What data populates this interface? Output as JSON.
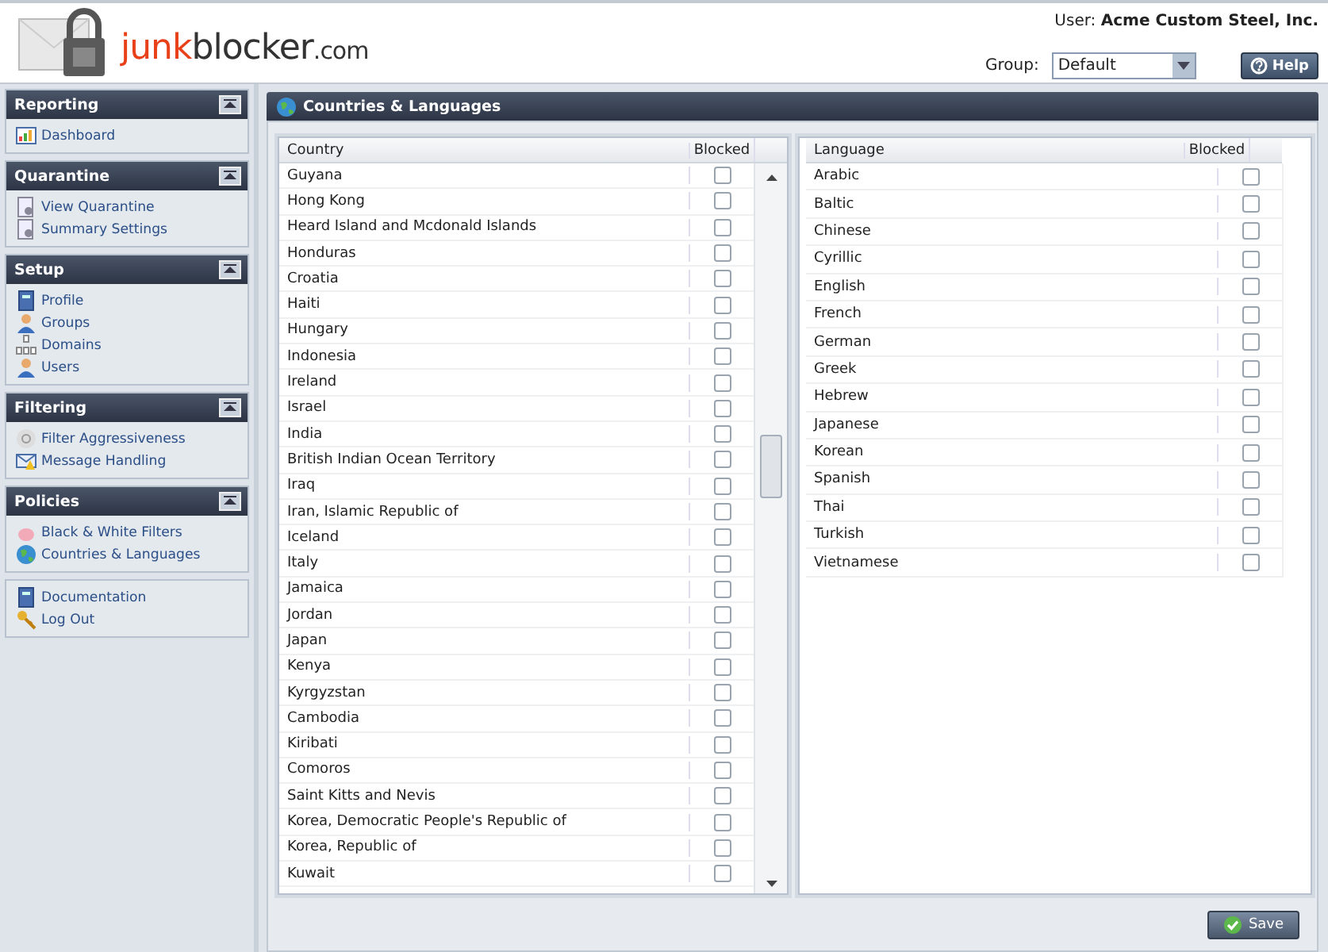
{
  "header": {
    "logo": {
      "accent": "junk",
      "name": "blocker",
      "suffix": ".com"
    },
    "user_label": "User:",
    "user_name": "Acme Custom Steel, Inc.",
    "group_label": "Group:",
    "group_value": "Default",
    "help": "Help"
  },
  "sidebar": [
    {
      "title": "Reporting",
      "items": [
        {
          "label": "Dashboard",
          "selected": false
        }
      ]
    },
    {
      "title": "Quarantine",
      "items": [
        {
          "label": "View Quarantine",
          "selected": false
        },
        {
          "label": "Summary Settings",
          "selected": false
        }
      ]
    },
    {
      "title": "Setup",
      "items": [
        {
          "label": "Profile",
          "selected": false
        },
        {
          "label": "Groups",
          "selected": false
        },
        {
          "label": "Domains",
          "selected": false
        },
        {
          "label": "Users",
          "selected": false
        }
      ]
    },
    {
      "title": "Filtering",
      "items": [
        {
          "label": "Filter Aggressiveness",
          "selected": false
        },
        {
          "label": "Message Handling",
          "selected": false
        }
      ]
    },
    {
      "title": "Policies",
      "items": [
        {
          "label": "Black & White Filters",
          "selected": false
        },
        {
          "label": "Countries & Languages",
          "selected": false
        }
      ]
    },
    {
      "items": [
        {
          "label": "Documentation",
          "selected": false
        },
        {
          "label": "Log Out",
          "selected": false
        }
      ]
    }
  ],
  "panel": {
    "title": "Countries & Languages",
    "countries": {
      "columns": [
        "Country",
        "Blocked"
      ],
      "rows": [
        {
          "name": "Guyana",
          "checked": false
        },
        {
          "name": "Hong Kong",
          "checked": false
        },
        {
          "name": "Heard Island and Mcdonald Islands",
          "checked": false
        },
        {
          "name": "Honduras",
          "checked": false
        },
        {
          "name": "Croatia",
          "checked": false
        },
        {
          "name": "Haiti",
          "checked": false
        },
        {
          "name": "Hungary",
          "checked": false
        },
        {
          "name": "Indonesia",
          "checked": false
        },
        {
          "name": "Ireland",
          "checked": false
        },
        {
          "name": "Israel",
          "checked": false
        },
        {
          "name": "India",
          "checked": false
        },
        {
          "name": "British Indian Ocean Territory",
          "checked": false
        },
        {
          "name": "Iraq",
          "checked": false
        },
        {
          "name": "Iran, Islamic Republic of",
          "checked": false
        },
        {
          "name": "Iceland",
          "checked": false
        },
        {
          "name": "Italy",
          "checked": false
        },
        {
          "name": "Jamaica",
          "checked": false
        },
        {
          "name": "Jordan",
          "checked": false
        },
        {
          "name": "Japan",
          "checked": false
        },
        {
          "name": "Kenya",
          "checked": false
        },
        {
          "name": "Kyrgyzstan",
          "checked": false
        },
        {
          "name": "Cambodia",
          "checked": false
        },
        {
          "name": "Kiribati",
          "checked": false
        },
        {
          "name": "Comoros",
          "checked": false
        },
        {
          "name": "Saint Kitts and Nevis",
          "checked": false
        },
        {
          "name": "Korea, Democratic People's Republic of",
          "checked": false
        },
        {
          "name": "Korea, Republic of",
          "checked": false
        },
        {
          "name": "Kuwait",
          "checked": false
        }
      ]
    },
    "languages": {
      "columns": [
        "Language",
        "Blocked"
      ],
      "rows": [
        {
          "name": "Arabic",
          "checked": false
        },
        {
          "name": "Baltic",
          "checked": false
        },
        {
          "name": "Chinese",
          "checked": false
        },
        {
          "name": "Cyrillic",
          "checked": false
        },
        {
          "name": "English",
          "checked": false
        },
        {
          "name": "French",
          "checked": false
        },
        {
          "name": "German",
          "checked": false
        },
        {
          "name": "Greek",
          "checked": false
        },
        {
          "name": "Hebrew",
          "checked": false
        },
        {
          "name": "Japanese",
          "checked": false
        },
        {
          "name": "Korean",
          "checked": false
        },
        {
          "name": "Spanish",
          "checked": false
        },
        {
          "name": "Thai",
          "checked": false
        },
        {
          "name": "Turkish",
          "checked": false
        },
        {
          "name": "Vietnamese",
          "checked": false
        }
      ]
    },
    "save": "Save"
  }
}
